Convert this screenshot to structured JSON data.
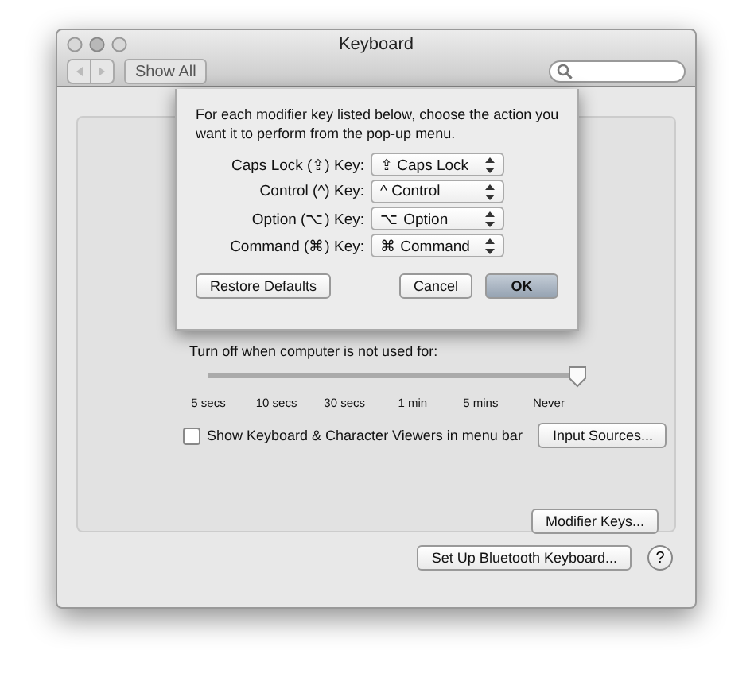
{
  "window": {
    "title": "Keyboard"
  },
  "toolbar": {
    "show_all": "Show All"
  },
  "sheet": {
    "message": "For each modifier key listed below, choose the action you want it to perform from the pop-up menu.",
    "mappings": [
      {
        "label": "Caps Lock (⇪) Key:",
        "value": "⇪ Caps Lock"
      },
      {
        "label": "Control (^) Key:",
        "value": "^ Control"
      },
      {
        "label": "Option (⌥) Key:",
        "value": "⌥ Option"
      },
      {
        "label": "Command (⌘) Key:",
        "value": "⌘ Command"
      }
    ],
    "restore": "Restore Defaults",
    "buttons": [
      {
        "label": "Cancel",
        "kind": "normal"
      },
      {
        "label": "OK",
        "kind": "default"
      }
    ]
  },
  "backlight": {
    "label": "Turn off when computer is not used for:",
    "level": 1,
    "ticks": [
      "5 secs",
      "10 secs",
      "30 secs",
      "1 min",
      "5 mins",
      "Never"
    ]
  },
  "viewer": {
    "label": "Show Keyboard & Character Viewers in menu bar",
    "checked": false,
    "button": "Input Sources..."
  },
  "modifier_button": "Modifier Keys...",
  "bluetooth_button": "Set Up Bluetooth Keyboard...",
  "help": "?"
}
